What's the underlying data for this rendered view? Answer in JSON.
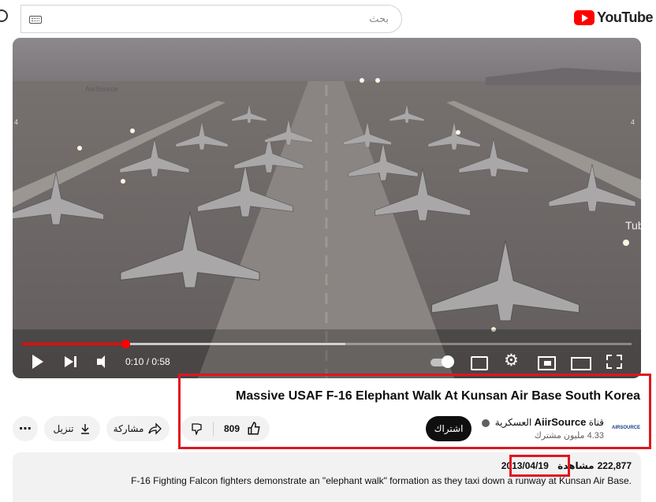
{
  "search": {
    "placeholder": "بحث"
  },
  "brand": {
    "name": "YouTube",
    "accent": "#ff0000"
  },
  "player": {
    "time_label": "0:10 / 0:58",
    "progress_fraction": 0.17,
    "buffer_fraction": 0.53,
    "watermark": "AiirSource"
  },
  "video": {
    "title": "Massive USAF F-16 Elephant Walk At Kunsan Air Base South Korea"
  },
  "channel": {
    "prefix": "قناة",
    "name": "AiirSource",
    "suffix": "العسكرية",
    "subscribers": "4.33 مليون مشترك",
    "avatar_text": "AIRSOURCE"
  },
  "actions": {
    "subscribe_label": "اشتراك",
    "like_count": "809",
    "share_label": "مشاركة",
    "download_label": "تنزيل",
    "more_label": "⋯"
  },
  "description": {
    "views": "222,877",
    "views_label": "مشاهدة",
    "date": "2013/04/19",
    "text": "F-16 Fighting Falcon fighters demonstrate an \"elephant walk\" formation as they taxi down a runway at Kunsan Air Base."
  },
  "colors": {
    "highlight": "#e0151f",
    "subscribe_bg": "#0f0f0f",
    "pill_bg": "#f2f2f2"
  }
}
